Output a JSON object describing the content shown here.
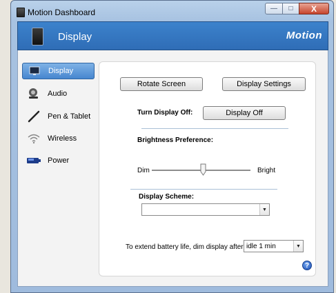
{
  "window": {
    "title": "Motion Dashboard",
    "controls": {
      "minimize": "—",
      "maximize": "□",
      "close": "X"
    }
  },
  "header": {
    "title": "Display",
    "logo": "Motion",
    "icon": "tablet-icon"
  },
  "sidebar": {
    "items": [
      {
        "label": "Display",
        "icon": "display-icon",
        "active": true
      },
      {
        "label": "Audio",
        "icon": "speaker-icon",
        "active": false
      },
      {
        "label": "Pen & Tablet",
        "icon": "pen-icon",
        "active": false
      },
      {
        "label": "Wireless",
        "icon": "wireless-icon",
        "active": false
      },
      {
        "label": "Power",
        "icon": "battery-icon",
        "active": false
      }
    ]
  },
  "panel": {
    "rotate_button": "Rotate Screen",
    "settings_button": "Display Settings",
    "turn_off_label": "Turn Display Off:",
    "display_off_button": "Display Off",
    "brightness_label": "Brightness Preference:",
    "brightness_min_label": "Dim",
    "brightness_max_label": "Bright",
    "brightness_level": 0.52,
    "scheme_label": "Display Scheme:",
    "scheme_value": "",
    "dim_label": "To extend battery life, dim display after:",
    "dim_value": "idle 1 min",
    "help_glyph": "?"
  },
  "colors": {
    "header_blue": "#2f6db6",
    "active_nav": "#4686cf",
    "separator": "#a9c0d6",
    "close_red": "#c6452d"
  }
}
